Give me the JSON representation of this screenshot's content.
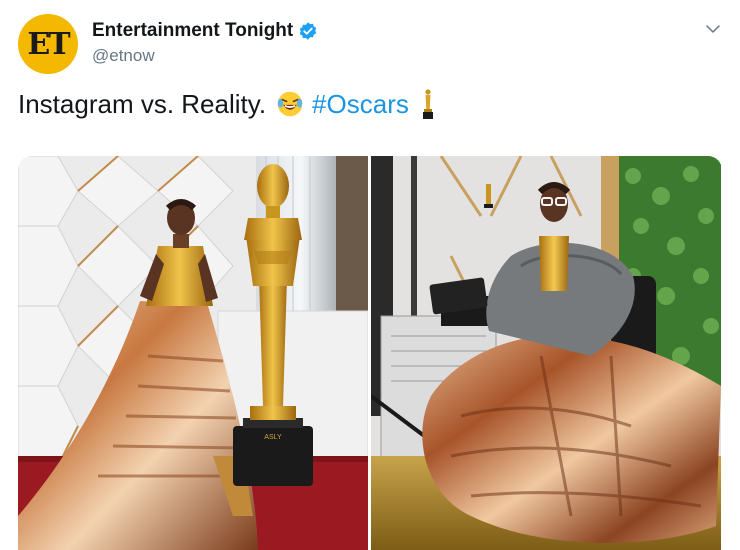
{
  "account": {
    "display_name": "Entertainment Tonight",
    "handle": "@etnow",
    "avatar_text": "ET",
    "verified": true
  },
  "tweet": {
    "text": "Instagram vs. Reality.",
    "emoji": "face-with-tears-of-joy",
    "hashtag": "#Oscars",
    "trailing_icon": "oscar-statuette-icon"
  },
  "media": {
    "photos": [
      {
        "name": "red-carpet-photo",
        "statue_label": "ASLY"
      },
      {
        "name": "backstage-photo"
      }
    ]
  },
  "colors": {
    "link": "#1b95e0",
    "handle": "#657786",
    "avatar_bg": "#f5b800",
    "verified": "#1da1f2"
  }
}
